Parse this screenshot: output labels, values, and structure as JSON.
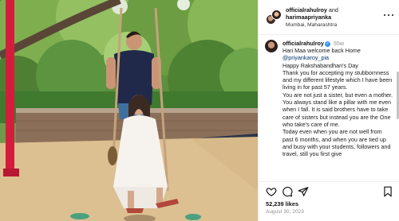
{
  "header": {
    "user": "officialrahulroy",
    "and_text": " and",
    "collab_user": "harimaapriyanka",
    "location": "Mumbai, Maharashtra"
  },
  "caption": {
    "user": "officialrahulroy",
    "verified_glyph": "✓",
    "time": "55w",
    "paragraphs": [
      "Hari Maa welcome back Home",
      "@priyankaroy_pia",
      "Happy Rakshabandhan's Day",
      "Thank you for accepting my stubbornness and my different lifestyle which I have been living in for past 57 years.",
      "You are not just a sister, but even a mother. You always stand like a pillar with me even when I fall. It is said brothers have to take care of sisters but instead you are the One who take's care of me.",
      "Today even when you are not well from past 6 months, and when you are tied up and busy with your students, followers and travel, still you first give"
    ]
  },
  "actions": {
    "heart_icon": "heart-icon",
    "comment_icon": "comment-icon",
    "share_icon": "share-icon",
    "save_icon": "bookmark-icon"
  },
  "likes": "52,239 likes",
  "date": "August 30, 2023",
  "colors": {
    "mention": "#00376b",
    "verified": "#3897f0",
    "muted": "#8e8e8e"
  }
}
